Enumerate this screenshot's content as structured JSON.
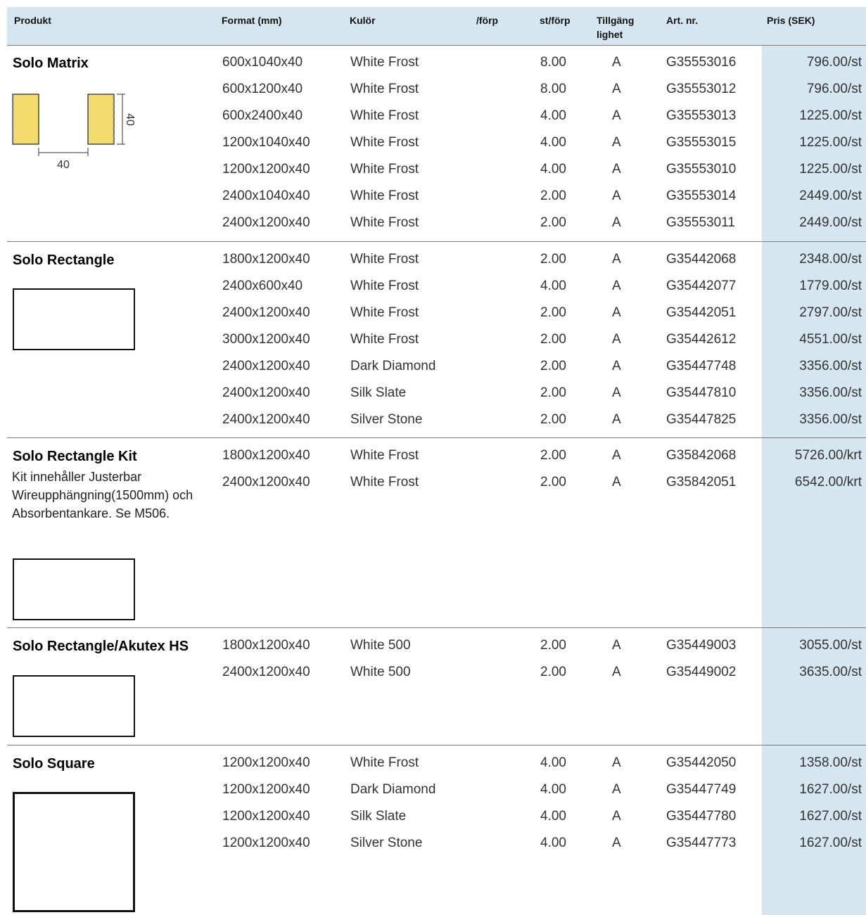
{
  "headers": {
    "produkt": "Produkt",
    "format": "Format (mm)",
    "kulor": "Kulör",
    "forp": "/förp",
    "st_forp": "st/förp",
    "tillganglighet_1": "Tillgäng",
    "tillganglighet_2": "lighet",
    "art_nr": "Art. nr.",
    "pris": "Pris (SEK)"
  },
  "colors": {
    "header_bg": "#d6e6f0",
    "price_col_bg": "#d6e6f0",
    "matrix_panel": "#f3db6e"
  },
  "sections": [
    {
      "name": "Solo Matrix",
      "desc": "",
      "dim_vertical": "40",
      "dim_horizontal": "40",
      "rows": [
        {
          "format": "600x1040x40",
          "color": "White Frost",
          "st": "8.00",
          "avail": "A",
          "art": "G35553016",
          "price": "796.00/st"
        },
        {
          "format": "600x1200x40",
          "color": "White Frost",
          "st": "8.00",
          "avail": "A",
          "art": "G35553012",
          "price": "796.00/st"
        },
        {
          "format": "600x2400x40",
          "color": "White Frost",
          "st": "4.00",
          "avail": "A",
          "art": "G35553013",
          "price": "1225.00/st"
        },
        {
          "format": "1200x1040x40",
          "color": "White Frost",
          "st": "4.00",
          "avail": "A",
          "art": "G35553015",
          "price": "1225.00/st"
        },
        {
          "format": "1200x1200x40",
          "color": "White Frost",
          "st": "4.00",
          "avail": "A",
          "art": "G35553010",
          "price": "1225.00/st"
        },
        {
          "format": "2400x1040x40",
          "color": "White Frost",
          "st": "2.00",
          "avail": "A",
          "art": "G35553014",
          "price": "2449.00/st"
        },
        {
          "format": "2400x1200x40",
          "color": "White Frost",
          "st": "2.00",
          "avail": "A",
          "art": "G35553011",
          "price": "2449.00/st"
        }
      ]
    },
    {
      "name": "Solo Rectangle",
      "desc": "",
      "rows": [
        {
          "format": "1800x1200x40",
          "color": "White Frost",
          "st": "2.00",
          "avail": "A",
          "art": "G35442068",
          "price": "2348.00/st"
        },
        {
          "format": "2400x600x40",
          "color": "White Frost",
          "st": "4.00",
          "avail": "A",
          "art": "G35442077",
          "price": "1779.00/st"
        },
        {
          "format": "2400x1200x40",
          "color": "White Frost",
          "st": "2.00",
          "avail": "A",
          "art": "G35442051",
          "price": "2797.00/st"
        },
        {
          "format": "3000x1200x40",
          "color": "White Frost",
          "st": "2.00",
          "avail": "A",
          "art": "G35442612",
          "price": "4551.00/st"
        },
        {
          "format": "2400x1200x40",
          "color": "Dark Diamond",
          "st": "2.00",
          "avail": "A",
          "art": "G35447748",
          "price": "3356.00/st"
        },
        {
          "format": "2400x1200x40",
          "color": "Silk Slate",
          "st": "2.00",
          "avail": "A",
          "art": "G35447810",
          "price": "3356.00/st"
        },
        {
          "format": "2400x1200x40",
          "color": "Silver Stone",
          "st": "2.00",
          "avail": "A",
          "art": "G35447825",
          "price": "3356.00/st"
        }
      ]
    },
    {
      "name": "Solo Rectangle Kit",
      "desc": "Kit innehåller Justerbar Wireupphängning(1500mm) och Absorbentankare. Se M506.",
      "rows": [
        {
          "format": "1800x1200x40",
          "color": "White Frost",
          "st": "2.00",
          "avail": "A",
          "art": "G35842068",
          "price": "5726.00/krt"
        },
        {
          "format": "2400x1200x40",
          "color": "White Frost",
          "st": "2.00",
          "avail": "A",
          "art": "G35842051",
          "price": "6542.00/krt"
        }
      ]
    },
    {
      "name": "Solo Rectangle/Akutex HS",
      "desc": "",
      "rows": [
        {
          "format": "1800x1200x40",
          "color": "White 500",
          "st": "2.00",
          "avail": "A",
          "art": "G35449003",
          "price": "3055.00/st"
        },
        {
          "format": "2400x1200x40",
          "color": "White 500",
          "st": "2.00",
          "avail": "A",
          "art": "G35449002",
          "price": "3635.00/st"
        }
      ]
    },
    {
      "name": "Solo Square",
      "desc": "",
      "rows": [
        {
          "format": "1200x1200x40",
          "color": "White Frost",
          "st": "4.00",
          "avail": "A",
          "art": "G35442050",
          "price": "1358.00/st"
        },
        {
          "format": "1200x1200x40",
          "color": "Dark Diamond",
          "st": "4.00",
          "avail": "A",
          "art": "G35447749",
          "price": "1627.00/st"
        },
        {
          "format": "1200x1200x40",
          "color": "Silk Slate",
          "st": "4.00",
          "avail": "A",
          "art": "G35447780",
          "price": "1627.00/st"
        },
        {
          "format": "1200x1200x40",
          "color": "Silver Stone",
          "st": "4.00",
          "avail": "A",
          "art": "G35447773",
          "price": "1627.00/st"
        }
      ]
    }
  ]
}
